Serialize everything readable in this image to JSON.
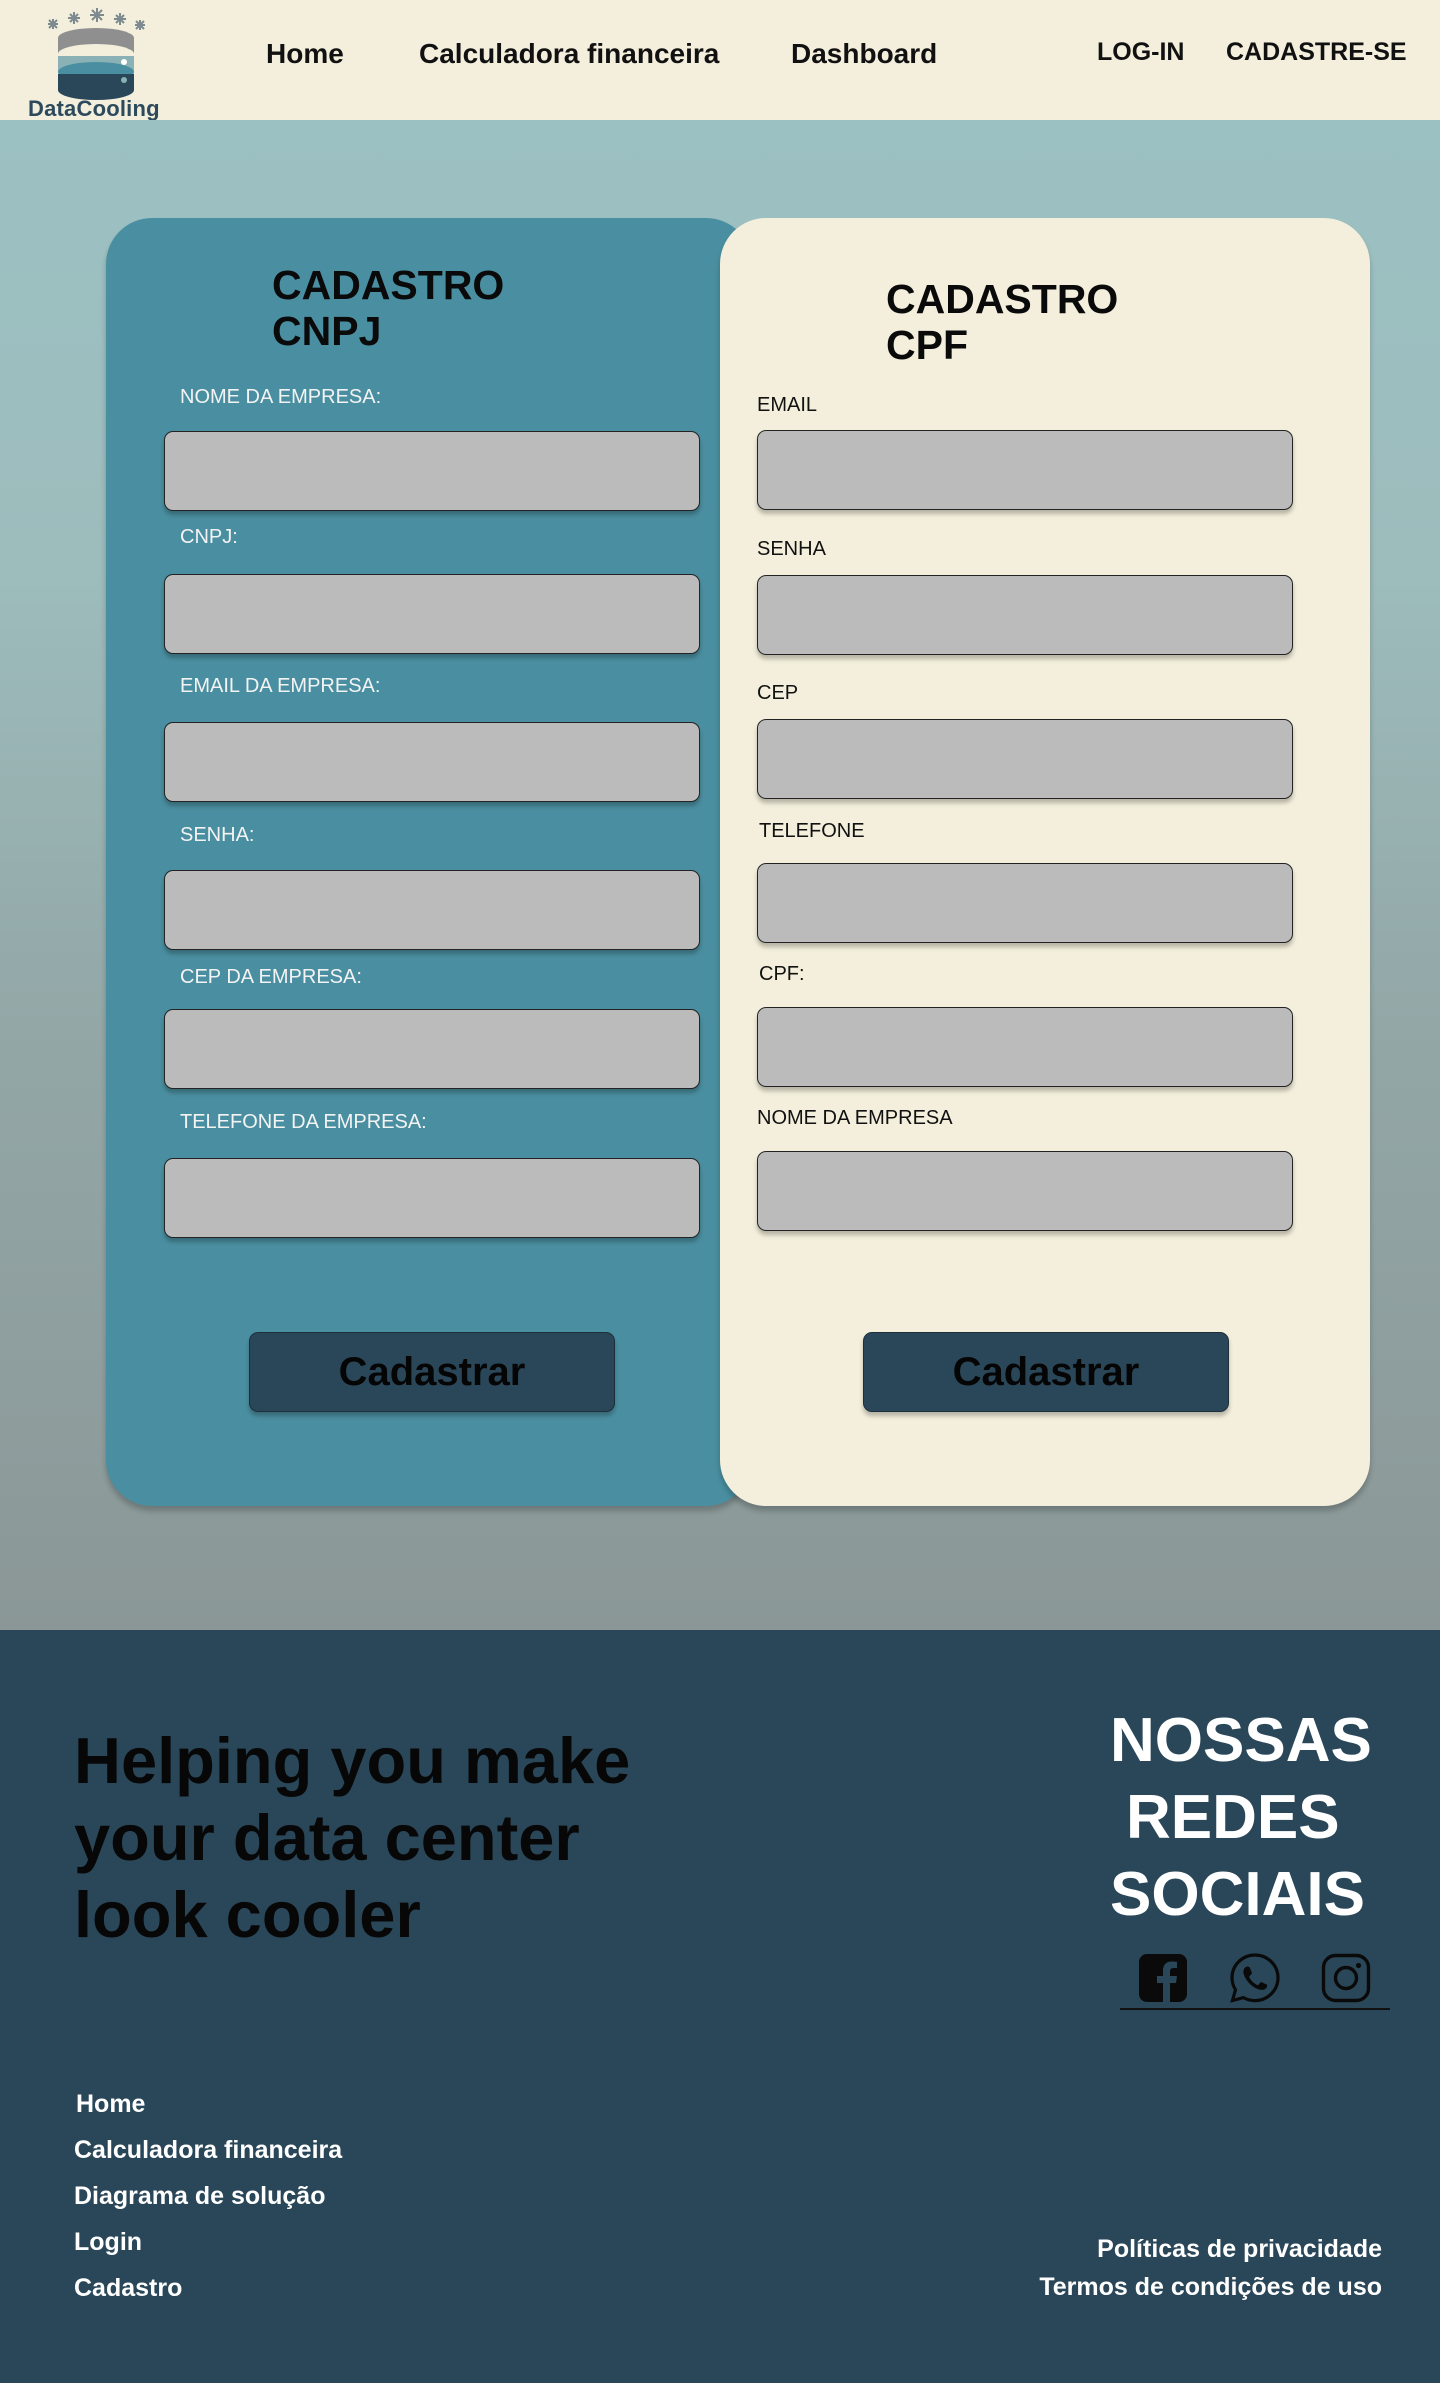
{
  "brand": {
    "logo_text": "DataCooling"
  },
  "header": {
    "nav": [
      "Home",
      "Calculadora financeira",
      "Dashboard"
    ],
    "login": "LOG-IN",
    "signup": "CADASTRE-SE"
  },
  "cnpj_form": {
    "title_line1": "CADASTRO",
    "title_line2": "CNPJ",
    "fields": [
      {
        "label": "NOME DA EMPRESA:",
        "value": ""
      },
      {
        "label": "CNPJ:",
        "value": ""
      },
      {
        "label": "EMAIL DA EMPRESA:",
        "value": ""
      },
      {
        "label": "SENHA:",
        "value": ""
      },
      {
        "label": "CEP DA EMPRESA:",
        "value": ""
      },
      {
        "label": "TELEFONE DA EMPRESA:",
        "value": ""
      }
    ],
    "submit": "Cadastrar"
  },
  "cpf_form": {
    "title_line1": "CADASTRO",
    "title_line2": "CPF",
    "fields": [
      {
        "label": "EMAIL",
        "value": ""
      },
      {
        "label": "SENHA",
        "value": ""
      },
      {
        "label": "CEP",
        "value": ""
      },
      {
        "label": "TELEFONE",
        "value": ""
      },
      {
        "label": "CPF:",
        "value": ""
      },
      {
        "label": "NOME DA EMPRESA",
        "value": ""
      }
    ],
    "submit": "Cadastrar"
  },
  "footer": {
    "tagline_line1": "Helping you make",
    "tagline_line2": "your data center",
    "tagline_line3": "look cooler",
    "social_title_line1": "NOSSAS",
    "social_title_line2": "REDES",
    "social_title_line3": "SOCIAIS",
    "social_icons": [
      "facebook-icon",
      "whatsapp-icon",
      "instagram-icon"
    ],
    "links": [
      "Home",
      "Calculadora financeira",
      "Diagrama de solução",
      "Login",
      "Cadastro"
    ],
    "privacy": "Políticas de privacidade",
    "terms": "Termos de condições de uso"
  },
  "colors": {
    "header_bg": "#f3efdc",
    "cnpj_card": "#4a8fa1",
    "cpf_card": "#f3efdc",
    "footer_bg": "#2a4759",
    "input_bg": "#bbbbbb",
    "button_bg": "#2a4759"
  }
}
